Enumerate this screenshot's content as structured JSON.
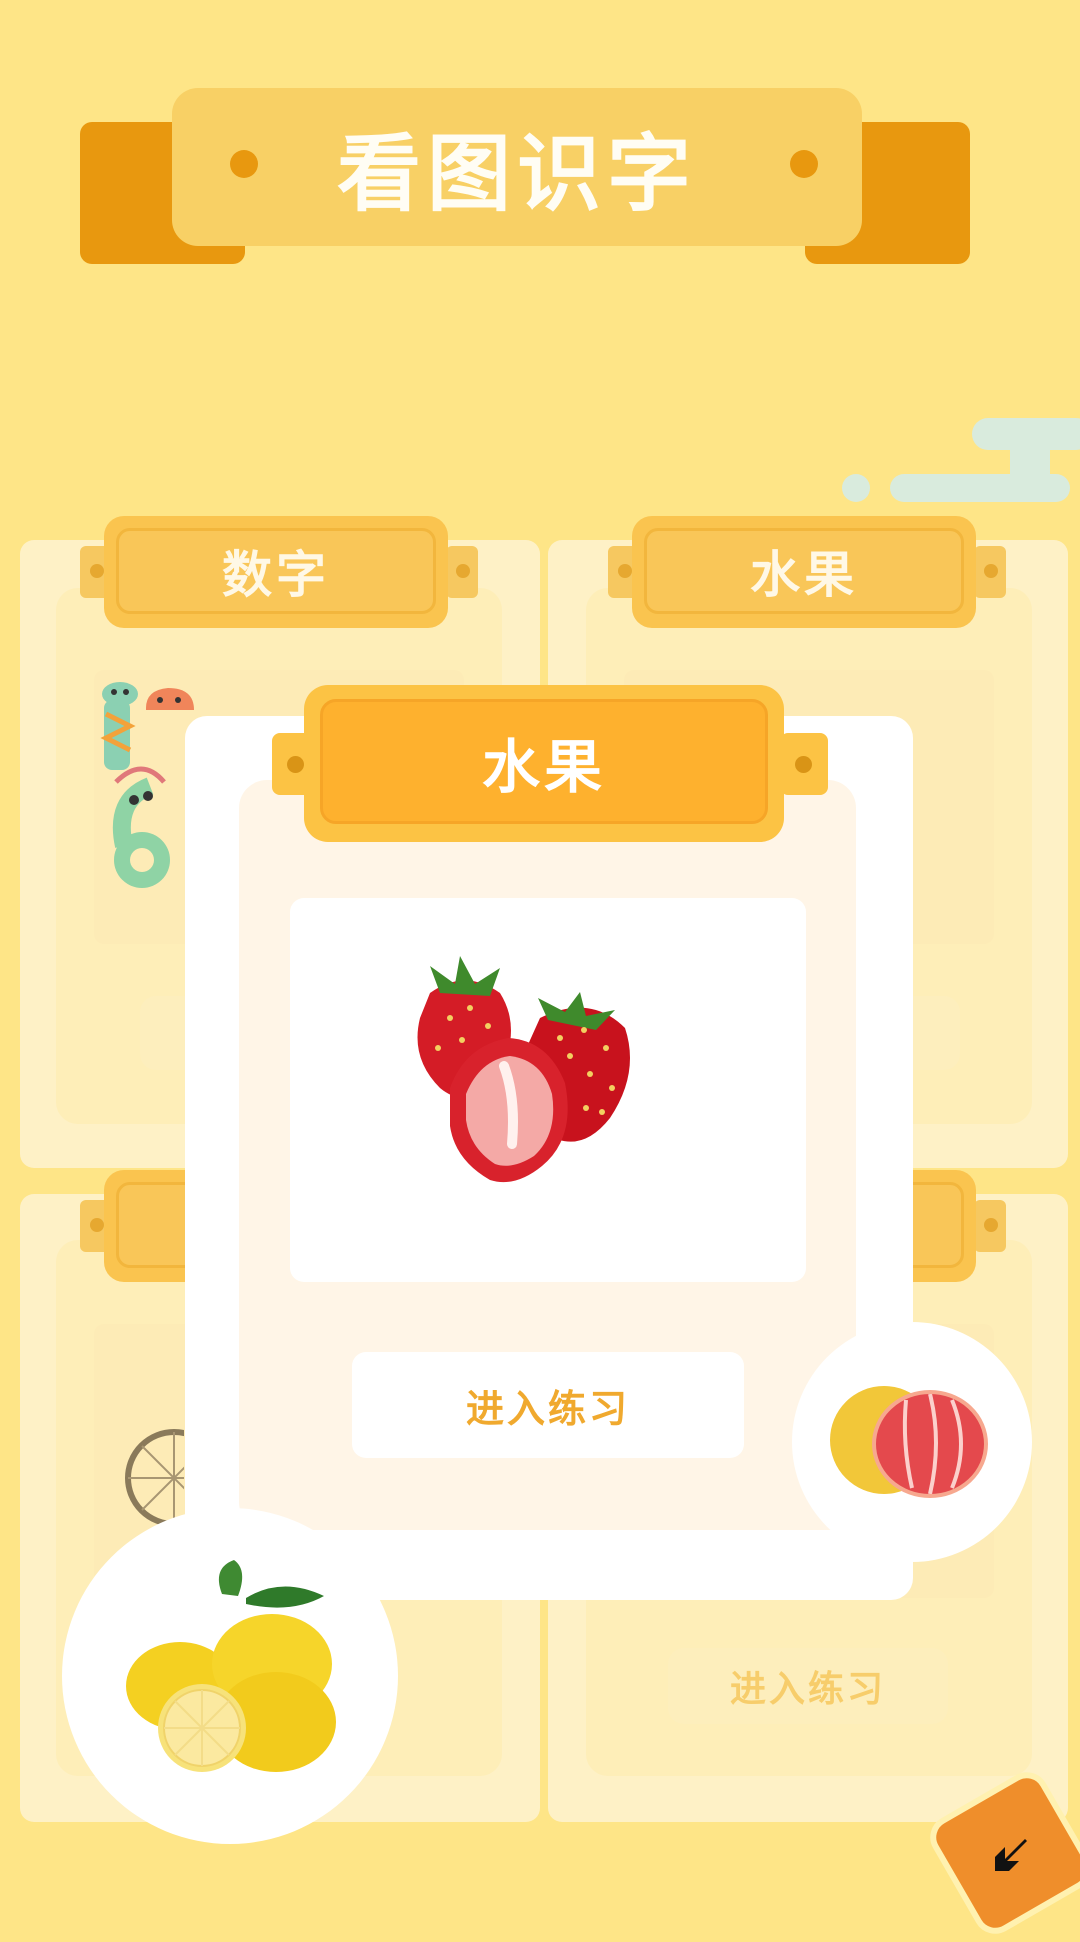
{
  "header": {
    "title": "看图识字"
  },
  "categories": [
    {
      "label": "数字"
    },
    {
      "label": "水果"
    },
    {
      "label": ""
    },
    {
      "label": "",
      "enter_label": "进入练习"
    }
  ],
  "popup": {
    "title": "水果",
    "image": "strawberry",
    "enter_label": "进入练习"
  },
  "bubbles": {
    "left": "lemon",
    "right": "grapefruit"
  },
  "back_button": {
    "icon": "back-arrow-icon"
  },
  "colors": {
    "background": "#fee587",
    "ribbon_tail": "#e8980f",
    "ribbon_face": "#f8d065",
    "tab_orange": "#feb12e",
    "enter_text": "#f0a92e"
  }
}
